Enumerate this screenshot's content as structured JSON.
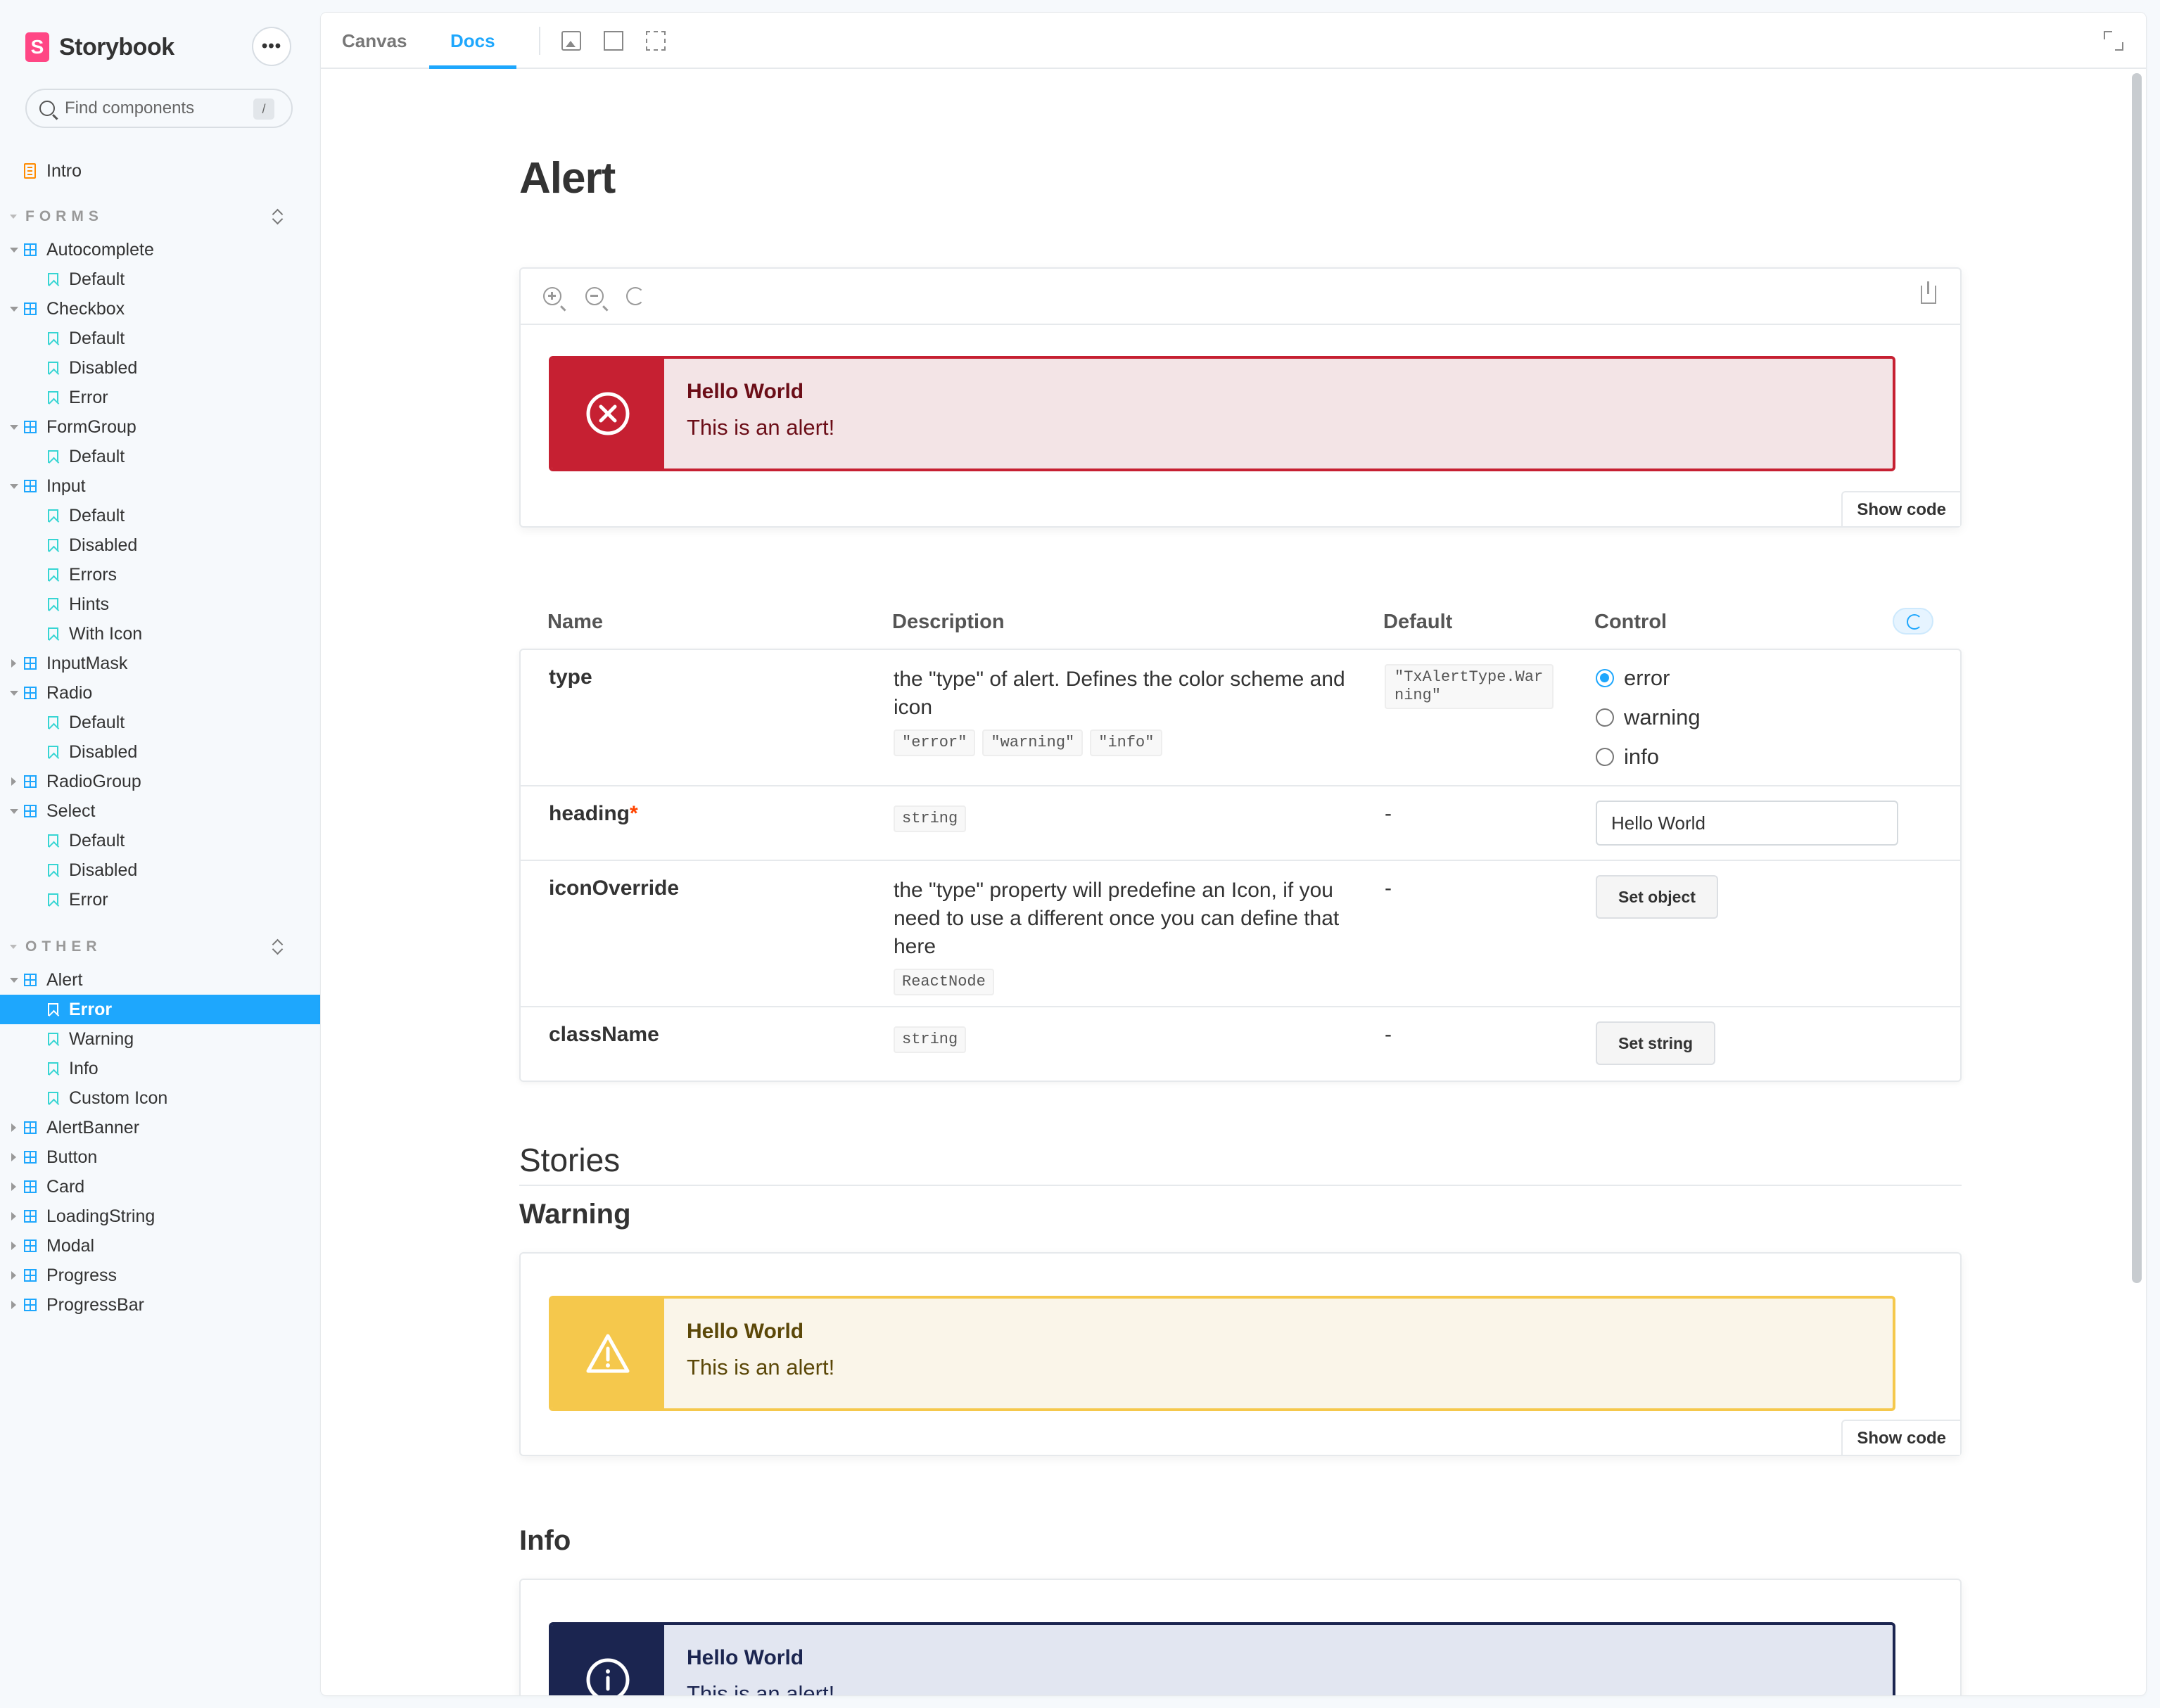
{
  "sidebar": {
    "brand": "Storybook",
    "more_label": "•••",
    "search_placeholder": "Find components",
    "search_shortcut": "/",
    "intro": "Intro",
    "groups": [
      {
        "title": "FORMS",
        "components": [
          {
            "name": "Autocomplete",
            "expanded": true,
            "stories": [
              "Default"
            ]
          },
          {
            "name": "Checkbox",
            "expanded": true,
            "stories": [
              "Default",
              "Disabled",
              "Error"
            ]
          },
          {
            "name": "FormGroup",
            "expanded": true,
            "stories": [
              "Default"
            ]
          },
          {
            "name": "Input",
            "expanded": true,
            "stories": [
              "Default",
              "Disabled",
              "Errors",
              "Hints",
              "With Icon"
            ]
          },
          {
            "name": "InputMask",
            "expanded": false,
            "stories": []
          },
          {
            "name": "Radio",
            "expanded": true,
            "stories": [
              "Default",
              "Disabled"
            ]
          },
          {
            "name": "RadioGroup",
            "expanded": false,
            "stories": []
          },
          {
            "name": "Select",
            "expanded": true,
            "stories": [
              "Default",
              "Disabled",
              "Error"
            ]
          }
        ]
      },
      {
        "title": "OTHER",
        "components": [
          {
            "name": "Alert",
            "expanded": true,
            "stories": [
              "Error",
              "Warning",
              "Info",
              "Custom Icon"
            ],
            "selected": "Error"
          },
          {
            "name": "AlertBanner",
            "expanded": false,
            "stories": []
          },
          {
            "name": "Button",
            "expanded": false,
            "stories": []
          },
          {
            "name": "Card",
            "expanded": false,
            "stories": []
          },
          {
            "name": "LoadingString",
            "expanded": false,
            "stories": []
          },
          {
            "name": "Modal",
            "expanded": false,
            "stories": []
          },
          {
            "name": "Progress",
            "expanded": false,
            "stories": []
          },
          {
            "name": "ProgressBar",
            "expanded": false,
            "stories": []
          }
        ]
      }
    ]
  },
  "toolbar": {
    "tabs": [
      "Canvas",
      "Docs"
    ],
    "active_tab": "Docs",
    "icons": [
      "image-icon",
      "grid-icon",
      "outline-icon",
      "fullscreen-icon"
    ]
  },
  "docs": {
    "title": "Alert",
    "primary": {
      "heading": "Hello World",
      "text": "This is an alert!",
      "show_code": "Show code"
    },
    "args": {
      "headers": {
        "name": "Name",
        "description": "Description",
        "default": "Default",
        "control": "Control"
      },
      "rows": [
        {
          "name": "type",
          "description": "the \"type\" of alert. Defines the color scheme and icon",
          "types": [
            "\"error\"",
            "\"warning\"",
            "\"info\""
          ],
          "default": "\"TxAlertType.Warning\"",
          "options": [
            "error",
            "warning",
            "info"
          ],
          "selected": "error"
        },
        {
          "name": "heading",
          "required_mark": "*",
          "types": [
            "string"
          ],
          "default": "-",
          "value": "Hello World"
        },
        {
          "name": "iconOverride",
          "description": "the \"type\" property will predefine an Icon, if you need to use a different once you can define that here",
          "types": [
            "ReactNode"
          ],
          "default": "-",
          "button": "Set object"
        },
        {
          "name": "className",
          "types": [
            "string"
          ],
          "default": "-",
          "button": "Set string"
        }
      ]
    },
    "stories_title": "Stories",
    "stories": [
      {
        "title": "Warning",
        "heading": "Hello World",
        "text": "This is an alert!",
        "show_code": "Show code"
      },
      {
        "title": "Info",
        "heading": "Hello World",
        "text": "This is an alert!"
      }
    ],
    "colors": {
      "error_border": "#c62032",
      "error_bg": "#f3e4e6",
      "error_text": "#6b0d17",
      "warning_border": "#f5c84c",
      "warning_bg": "#faf5e9",
      "warning_text": "#5b4708",
      "info_border": "#1b2550",
      "info_bg": "#e2e6f1",
      "info_text": "#1b2550"
    }
  }
}
